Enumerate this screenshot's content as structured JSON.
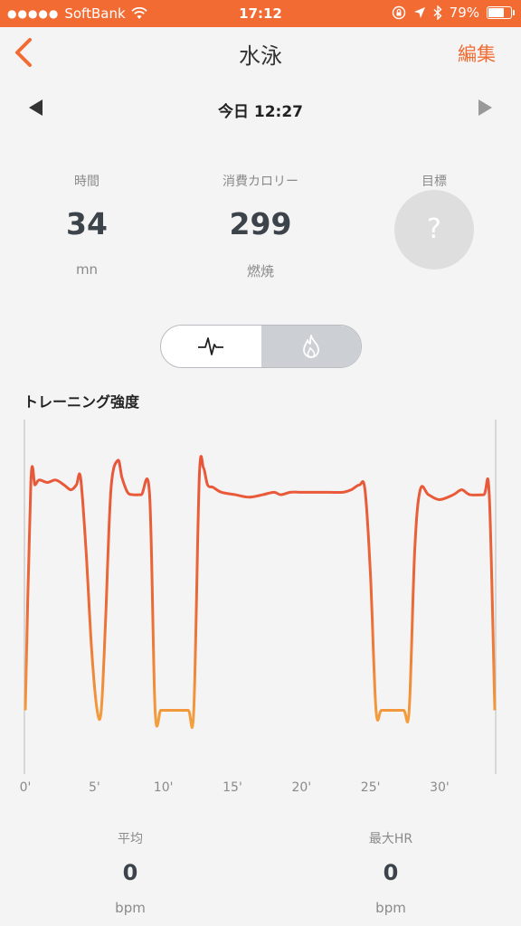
{
  "status_bar": {
    "carrier": "SoftBank",
    "time": "17:12",
    "battery_text": "79%",
    "battery_level": 0.79
  },
  "nav": {
    "title": "水泳",
    "edit_label": "編集"
  },
  "date_label": "今日 12:27",
  "stats": {
    "duration": {
      "label": "時間",
      "value": "34",
      "unit": "mn"
    },
    "calories": {
      "label": "消費カロリー",
      "value": "299",
      "unit": "燃焼"
    },
    "goal": {
      "label": "目標",
      "value": "?"
    }
  },
  "toggle": {
    "left_icon": "heartbeat-icon",
    "right_icon": "flame-icon",
    "selected": "right"
  },
  "colors": {
    "accent": "#f26b33",
    "line_top": "#e8553a",
    "line_bottom": "#f4a03c"
  },
  "section_title": "トレーニング強度",
  "chart_data": {
    "type": "line",
    "title": "",
    "xlabel": "",
    "ylabel": "",
    "x_tick_labels": [
      "0'",
      "5'",
      "10'",
      "15'",
      "20'",
      "25'",
      "30'"
    ],
    "x_ticks": [
      0,
      5,
      10,
      15,
      20,
      25,
      30
    ],
    "xlim": [
      0,
      34
    ],
    "ylim": [
      0,
      100
    ],
    "grid": false,
    "legend": "none",
    "series": [
      {
        "x": [
          0,
          0.4,
          0.7,
          1.0,
          1.6,
          2.2,
          2.8,
          3.3,
          3.7,
          4.0,
          4.4,
          4.8,
          5.2,
          5.5,
          5.8,
          6.2,
          6.7,
          7.0,
          7.4,
          7.8,
          8.4,
          9.0,
          9.4,
          9.8,
          10.2,
          11.0,
          11.8,
          12.2,
          12.6,
          12.9,
          13.2,
          13.6,
          14.2,
          15.2,
          16.2,
          17.2,
          18.0,
          18.5,
          19.2,
          20.0,
          21.0,
          22.0,
          23.0,
          23.6,
          24.2,
          24.6,
          25.0,
          25.4,
          25.8,
          26.6,
          27.4,
          27.8,
          28.2,
          28.6,
          29.2,
          30.0,
          31.0,
          31.6,
          32.2,
          33.2,
          33.6,
          34.0
        ],
        "values": [
          5,
          98,
          97,
          99,
          98,
          99,
          97,
          95,
          97,
          100,
          70,
          30,
          5,
          5,
          40,
          95,
          107,
          100,
          94,
          93,
          93,
          93,
          5,
          5,
          5,
          5,
          5,
          5,
          100,
          104,
          97,
          96,
          94,
          93,
          92,
          93,
          94,
          93,
          94,
          94,
          94,
          94,
          94,
          95,
          97,
          95,
          60,
          5,
          5,
          5,
          5,
          5,
          70,
          95,
          93,
          91,
          93,
          95,
          93,
          93,
          93,
          5
        ]
      }
    ]
  },
  "bottom_stats": {
    "average": {
      "label": "平均",
      "value": "0",
      "unit": "bpm"
    },
    "max_hr": {
      "label": "最大HR",
      "value": "0",
      "unit": "bpm"
    }
  }
}
